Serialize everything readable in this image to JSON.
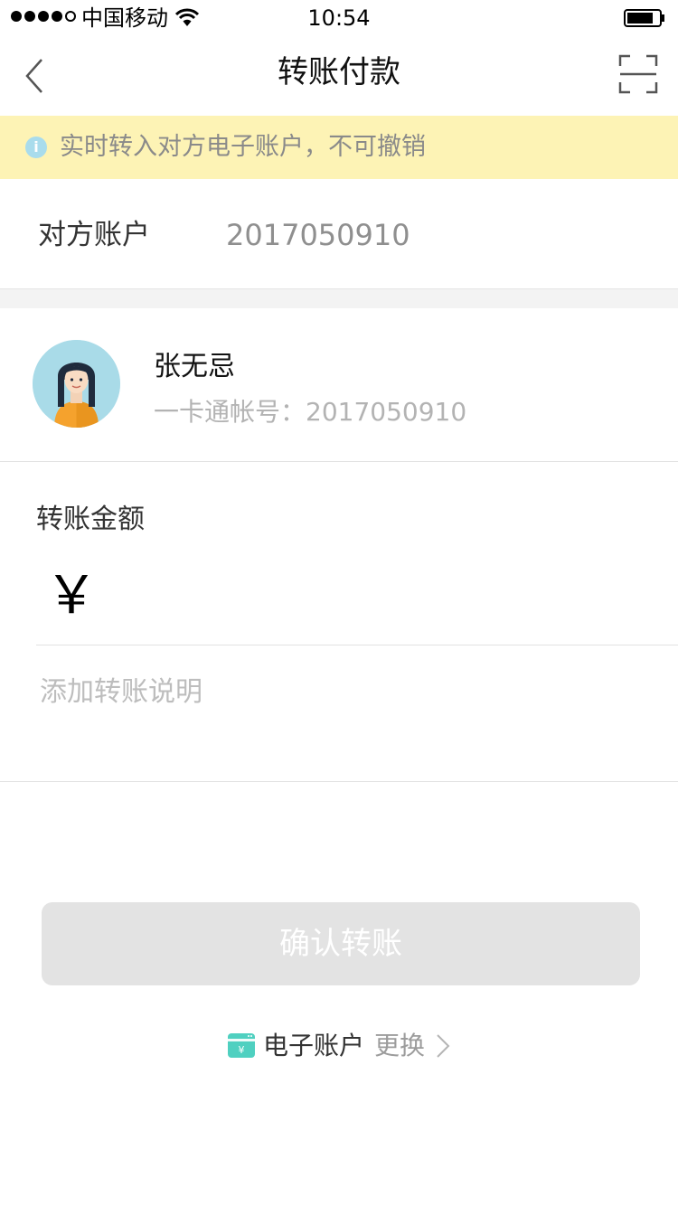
{
  "status_bar": {
    "carrier": "中国移动",
    "time": "10:54"
  },
  "nav": {
    "title": "转账付款"
  },
  "notice": {
    "icon": "info-icon",
    "text": "实时转入对方电子账户，不可撤销"
  },
  "account": {
    "label": "对方账户",
    "value": "2017050910"
  },
  "payee": {
    "name": "张无忌",
    "card_line": "一卡通帐号：2017050910"
  },
  "amount": {
    "label": "转账金额",
    "currency_symbol": "￥",
    "value": ""
  },
  "memo": {
    "placeholder": "添加转账说明"
  },
  "confirm": {
    "label": "确认转账"
  },
  "payment_method": {
    "name": "电子账户",
    "change_label": "更换"
  },
  "colors": {
    "notice_bg": "#fdf3b5",
    "notice_icon": "#a9dcec",
    "button_disabled": "#e3e3e3",
    "wallet_accent": "#4fd0c0"
  }
}
